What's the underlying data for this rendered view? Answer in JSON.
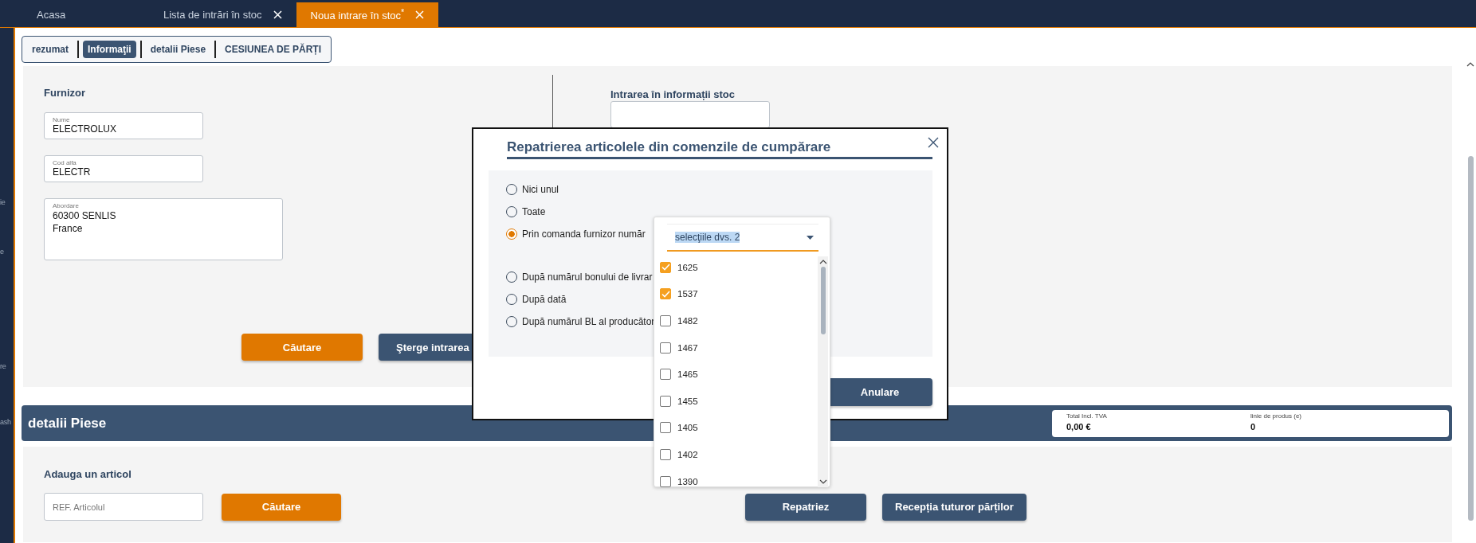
{
  "sidebar": {
    "items": [
      {
        "label": "ie"
      },
      {
        "label": "e"
      },
      {
        "label": "re"
      },
      {
        "label": "ash"
      }
    ]
  },
  "tabs": [
    {
      "label": "Acasa",
      "selected": false,
      "closable": false
    },
    {
      "label": "Lista de intrări în stoc",
      "selected": false,
      "closable": true
    },
    {
      "label": "Noua intrare în stoc$^{*}$",
      "selected": true,
      "closable": true
    }
  ],
  "section_nav": [
    {
      "label": "rezumat",
      "selected": false
    },
    {
      "label": "Informaţii",
      "selected": true
    },
    {
      "label": "detalii Piese",
      "selected": false
    },
    {
      "label": "CESIUNEA DE PĂRȚI",
      "selected": false
    }
  ],
  "supplier": {
    "title": "Furnizor",
    "fields": [
      {
        "label": "Nume",
        "value": "ELECTROLUX"
      },
      {
        "label": "Cod alfa",
        "value": "ELECTR"
      }
    ],
    "address": {
      "label": "Abordare",
      "lines": [
        "60300 SENLIS",
        "France"
      ]
    }
  },
  "stock_info": {
    "title": "Intrarea în informații stoc"
  },
  "actions": [
    {
      "label": "Căutare",
      "kind": "primary"
    },
    {
      "label": "Şterge intrarea",
      "kind": "secondary"
    }
  ],
  "parts": {
    "title": "detalii Piese",
    "summary": [
      {
        "label": "Total Incl. TVA",
        "value": "0,00 €"
      },
      {
        "label": "linie de produs (e)",
        "value": "0"
      }
    ],
    "add_title": "Adauga un articol",
    "ref_placeholder": "REF. Articolul",
    "search_button": "Căutare",
    "buttons": [
      "Repatriez",
      "Recepția tuturor părților"
    ]
  },
  "dialog": {
    "title": "Repatrierea articolele din comenzile de cumpărare",
    "options": [
      {
        "label": "Nici unul",
        "selected": false
      },
      {
        "label": "Toate",
        "selected": false
      },
      {
        "label": "Prin comanda furnizor număr",
        "selected": true
      },
      {
        "label": "După numărul bonului de livrar",
        "selected": false
      },
      {
        "label": "După dată",
        "selected": false
      },
      {
        "label": "După numărul BL al producător",
        "selected": false
      }
    ],
    "cancel": "Anulare",
    "dropdown": {
      "value": "selecţiile dvs. 2",
      "items": [
        {
          "label": "1625",
          "checked": true
        },
        {
          "label": "1537",
          "checked": true
        },
        {
          "label": "1482",
          "checked": false
        },
        {
          "label": "1467",
          "checked": false
        },
        {
          "label": "1465",
          "checked": false
        },
        {
          "label": "1455",
          "checked": false
        },
        {
          "label": "1405",
          "checked": false
        },
        {
          "label": "1402",
          "checked": false
        },
        {
          "label": "1390",
          "checked": false
        }
      ]
    }
  }
}
